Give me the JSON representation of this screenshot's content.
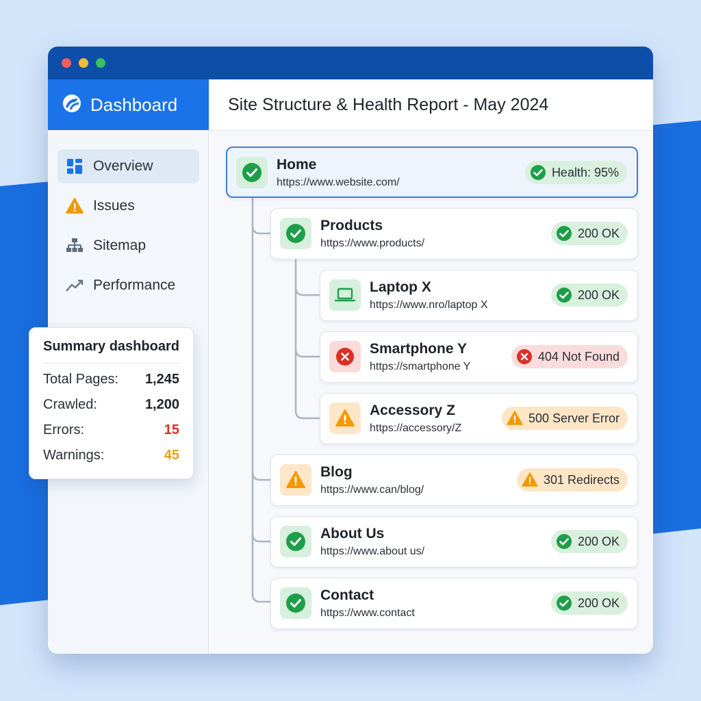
{
  "app": {
    "brand": "Dashboard",
    "report_title": "Site Structure & Health Report - May 2024"
  },
  "sidebar": {
    "items": [
      {
        "label": "Overview",
        "icon": "dashboard-grid-icon",
        "active": true
      },
      {
        "label": "Issues",
        "icon": "warning-icon"
      },
      {
        "label": "Sitemap",
        "icon": "sitemap-icon"
      },
      {
        "label": "Performance",
        "icon": "trend-up-icon"
      }
    ]
  },
  "summary": {
    "title": "Summary dashboard",
    "rows": [
      {
        "label": "Total Pages:",
        "value": "1,245",
        "color": "#1f2329"
      },
      {
        "label": "Crawled:",
        "value": "1,200",
        "color": "#1f2329"
      },
      {
        "label": "Errors:",
        "value": "15",
        "color": "#d93025"
      },
      {
        "label": "Warnings:",
        "value": "45",
        "color": "#e3a21a"
      }
    ]
  },
  "tree": {
    "home": {
      "title": "Home",
      "url": "https://www.website.com/",
      "badge": "Health: 95%",
      "status": "ok"
    },
    "products": {
      "title": "Products",
      "url": "https://www.products/",
      "badge": "200 OK",
      "status": "ok"
    },
    "laptop": {
      "title": "Laptop X",
      "url": "https://www.nro/laptop X",
      "badge": "200 OK",
      "status": "ok"
    },
    "smartphone": {
      "title": "Smartphone Y",
      "url": "https://smartphone Y",
      "badge": "404 Not Found",
      "status": "error"
    },
    "accessory": {
      "title": "Accessory Z",
      "url": "https://accessory/Z",
      "badge": "500 Server Error",
      "status": "warning"
    },
    "blog": {
      "title": "Blog",
      "url": "https://www.can/blog/",
      "badge": "301 Redirects",
      "status": "warning"
    },
    "about": {
      "title": "About Us",
      "url": "https://www.about us/",
      "badge": "200 OK",
      "status": "ok"
    },
    "contact": {
      "title": "Contact",
      "url": "https://www.contact",
      "badge": "200 OK",
      "status": "ok"
    }
  },
  "colors": {
    "brand_blue": "#1a73e8",
    "titlebar": "#0d4ea8",
    "ok_green": "#1e9e4a",
    "error_red": "#d93025",
    "warning_orange": "#f29900"
  }
}
